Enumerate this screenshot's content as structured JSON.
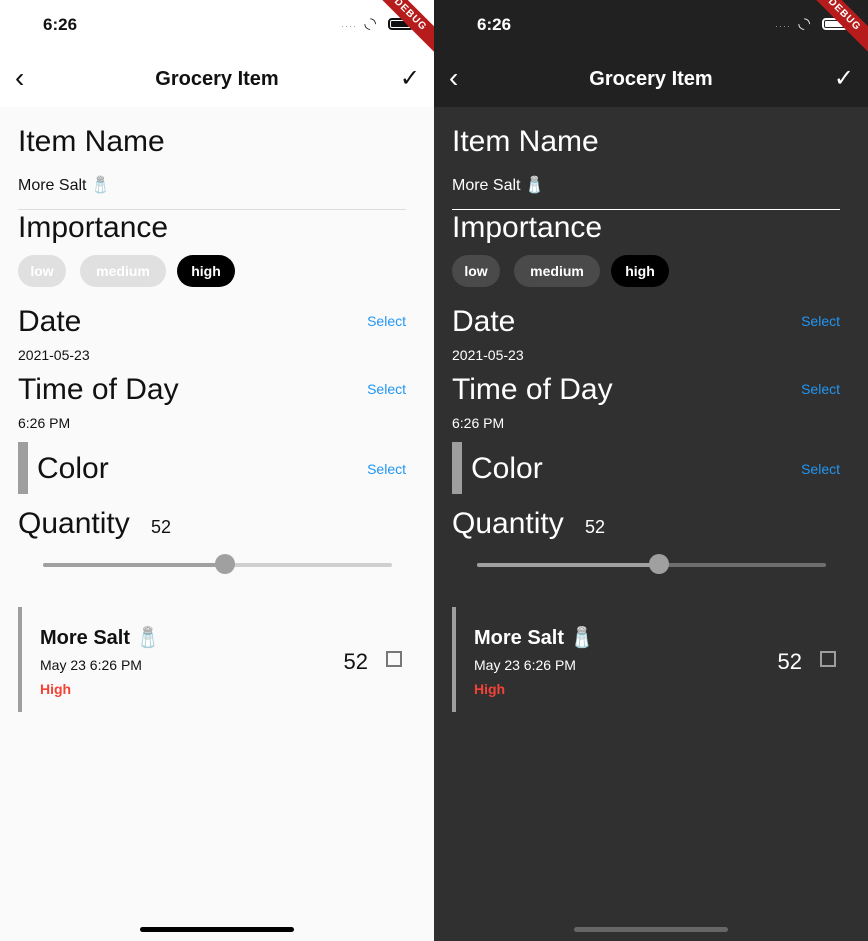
{
  "status": {
    "time": "6:26",
    "dots": "····",
    "wifi": "📶",
    "debug": "DEBUG"
  },
  "appbar": {
    "title": "Grocery Item",
    "back": "‹",
    "check": "✓"
  },
  "sections": {
    "item_name_label": "Item Name",
    "item_name_value": "More Salt 🧂",
    "importance_label": "Importance",
    "chips": [
      "low",
      "medium",
      "high"
    ],
    "date_label": "Date",
    "date_value": "2021-05-23",
    "time_label": "Time of Day",
    "time_value": "6:26 PM",
    "color_label": "Color",
    "select_label": "Select",
    "quantity_label": "Quantity",
    "quantity_value": "52"
  },
  "slider": {
    "value": 52,
    "min": 0,
    "max": 100
  },
  "card": {
    "name": "More Salt 🧂",
    "date": "May 23 6:26 PM",
    "importance": "High",
    "quantity": "52"
  }
}
